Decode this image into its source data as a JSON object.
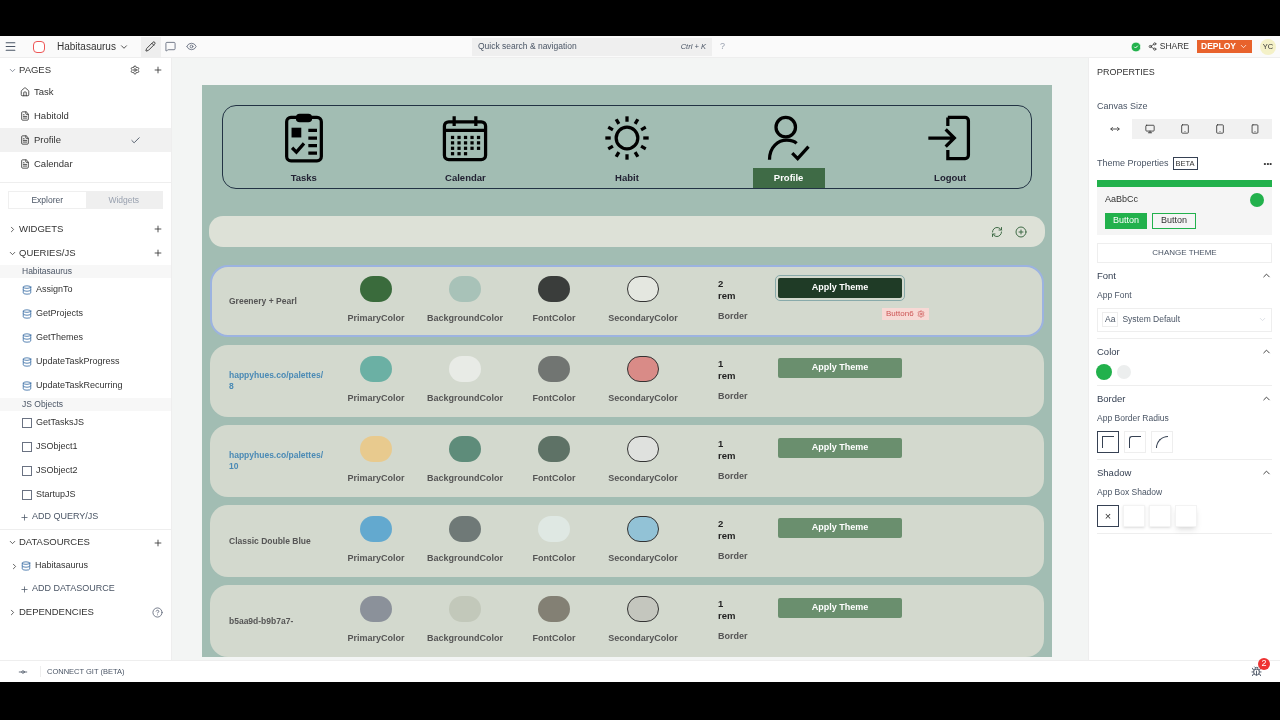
{
  "topbar": {
    "app_name": "Habitasaurus",
    "search_placeholder": "Quick search & navigation",
    "shortcut": "Ctrl + K",
    "help": "?",
    "share": "SHARE",
    "deploy": "DEPLOY",
    "avatar": "YC"
  },
  "sidebar": {
    "pages_title": "PAGES",
    "pages": [
      {
        "label": "Task",
        "kind": "home",
        "selected": false
      },
      {
        "label": "Habitold",
        "kind": "page",
        "selected": false
      },
      {
        "label": "Profile",
        "kind": "page",
        "selected": true
      },
      {
        "label": "Calendar",
        "kind": "page",
        "selected": false
      }
    ],
    "tabs": [
      {
        "label": "Explorer",
        "selected": true
      },
      {
        "label": "Widgets",
        "selected": false
      }
    ],
    "widgets_title": "WIDGETS",
    "queries_title": "QUERIES/JS",
    "query_groups": [
      {
        "label": "Habitasaurus",
        "items": [
          {
            "label": "AssignTo",
            "kind": "db"
          },
          {
            "label": "GetProjects",
            "kind": "db"
          },
          {
            "label": "GetThemes",
            "kind": "db"
          },
          {
            "label": "UpdateTaskProgress",
            "kind": "db"
          },
          {
            "label": "UpdateTaskRecurring",
            "kind": "db"
          }
        ]
      },
      {
        "label": "JS Objects",
        "items": [
          {
            "label": "GetTasksJS",
            "kind": "js"
          },
          {
            "label": "JSObject1",
            "kind": "js"
          },
          {
            "label": "JSObject2",
            "kind": "js"
          },
          {
            "label": "StartupJS",
            "kind": "js"
          }
        ]
      }
    ],
    "add_query": "ADD QUERY/JS",
    "datasources_title": "DATASOURCES",
    "datasources": [
      "Habitasaurus"
    ],
    "add_datasource": "ADD DATASOURCE",
    "dependencies_title": "DEPENDENCIES"
  },
  "nav": [
    {
      "label": "Tasks",
      "kind": "tasks",
      "selected": false
    },
    {
      "label": "Calendar",
      "kind": "calendar",
      "selected": false
    },
    {
      "label": "Habit",
      "kind": "sun",
      "selected": false
    },
    {
      "label": "Profile",
      "kind": "profile",
      "selected": true
    },
    {
      "label": "Logout",
      "kind": "logout",
      "selected": false
    }
  ],
  "themes": [
    {
      "name": "Greenery + Pearl",
      "kind": "plain",
      "selected": true,
      "swatches": [
        {
          "label": "PrimaryColor",
          "color": "#3a6b3c"
        },
        {
          "label": "BackgroundColor",
          "color": "#a8c2b8"
        },
        {
          "label": "FontColor",
          "color": "#3a3d3b"
        },
        {
          "label": "SecondaryColor",
          "color": "#e4e7e0"
        }
      ],
      "border_value": "2 rem",
      "border_label": "Border",
      "button": "Apply Theme",
      "widget_label": "Button6"
    },
    {
      "name": "happyhues.co/palettes/8",
      "kind": "link",
      "selected": false,
      "swatches": [
        {
          "label": "PrimaryColor",
          "color": "#6bb0a4"
        },
        {
          "label": "BackgroundColor",
          "color": "#e8ebe6"
        },
        {
          "label": "FontColor",
          "color": "#717572"
        },
        {
          "label": "SecondaryColor",
          "color": "#d98b87"
        }
      ],
      "border_value": "1 rem",
      "border_label": "Border",
      "button": "Apply Theme"
    },
    {
      "name": "happyhues.co/palettes/10",
      "kind": "link",
      "selected": false,
      "swatches": [
        {
          "label": "PrimaryColor",
          "color": "#e8ca8e"
        },
        {
          "label": "BackgroundColor",
          "color": "#5e8c7a"
        },
        {
          "label": "FontColor",
          "color": "#5e7266"
        },
        {
          "label": "SecondaryColor",
          "color": "#dfe1de"
        }
      ],
      "border_value": "1 rem",
      "border_label": "Border",
      "button": "Apply Theme"
    },
    {
      "name": "Classic Double Blue",
      "kind": "plain",
      "selected": false,
      "swatches": [
        {
          "label": "PrimaryColor",
          "color": "#63a9cf"
        },
        {
          "label": "BackgroundColor",
          "color": "#6f7977"
        },
        {
          "label": "FontColor",
          "color": "#dfe8e3"
        },
        {
          "label": "SecondaryColor",
          "color": "#92c2d6"
        }
      ],
      "border_value": "2 rem",
      "border_label": "Border",
      "button": "Apply Theme"
    },
    {
      "name": "b5aa9d-b9b7a7-",
      "kind": "plain",
      "selected": false,
      "swatches": [
        {
          "label": "PrimaryColor",
          "color": "#8b919a"
        },
        {
          "label": "BackgroundColor",
          "color": "#c2c8ba"
        },
        {
          "label": "FontColor",
          "color": "#838074"
        },
        {
          "label": "SecondaryColor",
          "color": "#c4c6be"
        }
      ],
      "border_value": "1 rem",
      "border_label": "Border",
      "button": "Apply Theme"
    }
  ],
  "properties": {
    "title": "PROPERTIES",
    "canvas_size": "Canvas Size",
    "canvas_options": [
      {
        "kind": "fluid",
        "selected": true
      },
      {
        "kind": "desktop",
        "selected": false
      },
      {
        "kind": "tablet",
        "selected": false
      },
      {
        "kind": "tablet",
        "selected": false
      },
      {
        "kind": "phone",
        "selected": false
      }
    ],
    "theme_properties": "Theme Properties",
    "beta": "BETA",
    "more": "•••",
    "preview_text": "AaBbCc",
    "preview_button": "Button",
    "preview_button_outline": "Button",
    "change_theme": "CHANGE THEME",
    "font_title": "Font",
    "app_font": "App Font",
    "font_icon": "Aa",
    "font_value": "System Default",
    "color_title": "Color",
    "colors": [
      {
        "color": "#22b14c",
        "selected": true
      },
      {
        "color": "#eceeee",
        "selected": false
      }
    ],
    "border_title": "Border",
    "border_radius": "App Border Radius",
    "radius_options": [
      {
        "kind": "none",
        "selected": true
      },
      {
        "kind": "small",
        "selected": false
      },
      {
        "kind": "large",
        "selected": false
      }
    ],
    "shadow_title": "Shadow",
    "box_shadow": "App Box Shadow",
    "shadow_options": [
      {
        "kind": "none",
        "label": "×",
        "selected": true
      },
      {
        "kind": "small",
        "selected": false
      },
      {
        "kind": "medium",
        "selected": false
      },
      {
        "kind": "large",
        "selected": false
      }
    ]
  },
  "bottom": {
    "git": "CONNECT GIT (BETA)",
    "badge": "2"
  }
}
